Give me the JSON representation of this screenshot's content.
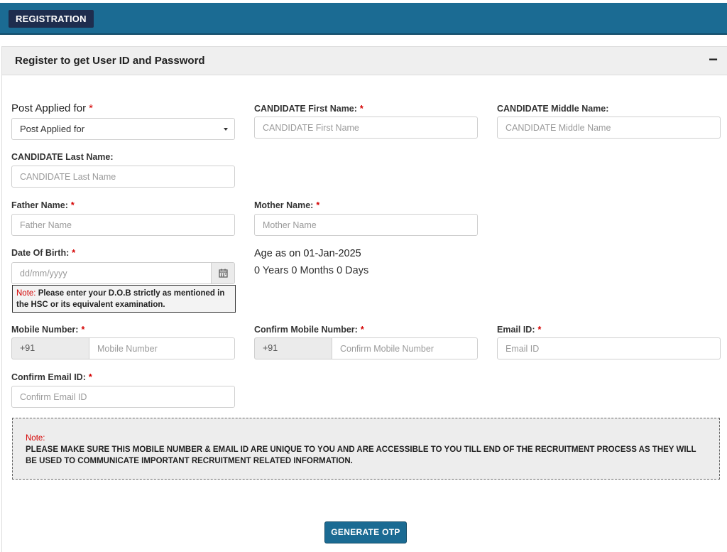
{
  "header": {
    "tab_label": "REGISTRATION"
  },
  "panel": {
    "title": "Register to get User ID and Password",
    "collapse_symbol": "−"
  },
  "form": {
    "post": {
      "label": "Post Applied for",
      "selected": "Post Applied for"
    },
    "first_name": {
      "label": "CANDIDATE First Name:",
      "placeholder": "CANDIDATE First Name"
    },
    "middle_name": {
      "label": "CANDIDATE Middle Name:",
      "placeholder": "CANDIDATE Middle Name"
    },
    "last_name": {
      "label": "CANDIDATE Last Name:",
      "placeholder": "CANDIDATE Last Name"
    },
    "father_name": {
      "label": "Father Name:",
      "placeholder": "Father Name"
    },
    "mother_name": {
      "label": "Mother Name:",
      "placeholder": "Mother Name"
    },
    "dob": {
      "label": "Date Of Birth:",
      "placeholder": "dd/mm/yyyy",
      "note_prefix": "Note:",
      "note_text": " Please enter your D.O.B strictly as mentioned in the HSC or its equivalent examination."
    },
    "age": {
      "title": "Age as on 01-Jan-2025",
      "value": "0 Years 0 Months 0 Days"
    },
    "mobile": {
      "label": "Mobile Number:",
      "prefix": "+91",
      "placeholder": "Mobile Number"
    },
    "confirm_mobile": {
      "label": "Confirm Mobile Number:",
      "prefix": "+91",
      "placeholder": "Confirm Mobile Number"
    },
    "email": {
      "label": "Email ID:",
      "placeholder": "Email ID"
    },
    "confirm_email": {
      "label": "Confirm Email ID:",
      "placeholder": "Confirm Email ID"
    },
    "required_mark": "*"
  },
  "notice": {
    "title": "Note:",
    "text": "PLEASE MAKE SURE THIS MOBILE NUMBER & EMAIL ID ARE UNIQUE TO YOU AND ARE ACCESSIBLE TO YOU TILL END OF THE RECRUITMENT PROCESS AS THEY WILL BE USED TO COMMUNICATE IMPORTANT RECRUITMENT RELATED INFORMATION."
  },
  "actions": {
    "generate_otp": "GENERATE OTP"
  },
  "colors": {
    "header_bar": "#1b6b93",
    "tab_bg": "#1e2d4e",
    "required": "#d40000",
    "button": "#1b6b93"
  },
  "icons": {
    "dob_button": "calendar-icon",
    "post_dropdown": "caret-down-icon"
  }
}
